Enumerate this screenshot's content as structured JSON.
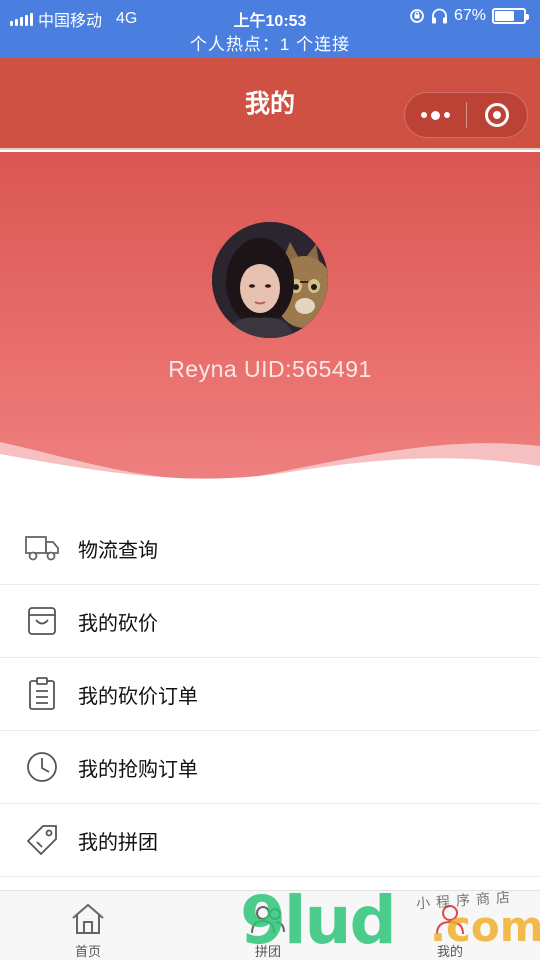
{
  "status_bar": {
    "carrier": "中国移动",
    "network": "4G",
    "time": "上午10:53",
    "battery": "67%",
    "battery_level": 0.67,
    "hotspot": "个人热点：1 个连接"
  },
  "navbar": {
    "title": "我的",
    "more_icon": "more-dots-icon",
    "close_icon": "target-circle-icon"
  },
  "profile": {
    "user_line": "Reyna UID:565491"
  },
  "menu": {
    "items": [
      {
        "label": "物流查询",
        "icon": "truck-icon"
      },
      {
        "label": "我的砍价",
        "icon": "shopping-box-icon"
      },
      {
        "label": "我的砍价订单",
        "icon": "clipboard-list-icon"
      },
      {
        "label": "我的抢购订单",
        "icon": "clock-icon"
      },
      {
        "label": "我的拼团",
        "icon": "tag-icon"
      }
    ]
  },
  "tabbar": {
    "tabs": [
      {
        "label": "首页",
        "icon": "home-icon"
      },
      {
        "label": "拼团",
        "icon": "group-icon"
      },
      {
        "label": "我的",
        "icon": "person-icon"
      }
    ]
  },
  "watermark": {
    "main": "9lud",
    "suffix": ".com",
    "handwritten": "小程序商店"
  },
  "colors": {
    "status_bg": "#4a7fe0",
    "nav_bg": "#cf5143",
    "profile_gradient_top": "#d95653",
    "profile_gradient_bottom": "#ef8383",
    "active_tab": "#e04848"
  }
}
